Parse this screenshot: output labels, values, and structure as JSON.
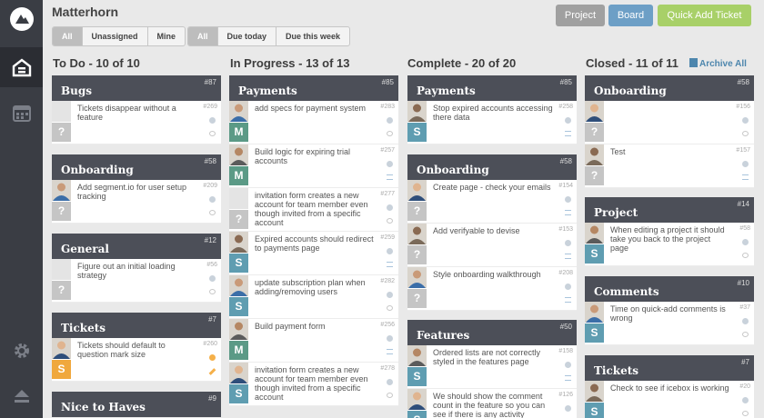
{
  "project_title": "Matterhorn",
  "filters": {
    "assignee": [
      {
        "label": "All",
        "active": true
      },
      {
        "label": "Unassigned",
        "active": false
      },
      {
        "label": "Mine",
        "active": false
      }
    ],
    "due": [
      {
        "label": "All",
        "active": true
      },
      {
        "label": "Due today",
        "active": false
      },
      {
        "label": "Due this week",
        "active": false
      }
    ]
  },
  "top_buttons": {
    "project": "Project",
    "board": "Board",
    "quick_add": "Quick Add Ticket"
  },
  "colors": {
    "project_button": "#a0a0a0",
    "board_button": "#6d9fc6",
    "quick_add_button": "#a8d068",
    "sidebar": "#3a3d44",
    "group_header": "#4c4f58"
  },
  "archive_all": "Archive All",
  "columns": [
    {
      "title": "To Do - 10 of 10",
      "groups": [
        {
          "name": "Bugs",
          "number": "#87",
          "tickets": [
            {
              "text": "Tickets disappear without a feature",
              "number": "#269",
              "initial": "?",
              "avatar": false
            }
          ]
        },
        {
          "name": "Onboarding",
          "number": "#58",
          "tickets": [
            {
              "text": "Add segment.io for user setup tracking",
              "number": "#209",
              "initial": "?",
              "avatar": true
            }
          ]
        },
        {
          "name": "General",
          "number": "#12",
          "tickets": [
            {
              "text": "Figure out an initial loading strategy",
              "number": "#56",
              "initial": "?",
              "avatar": false
            }
          ]
        },
        {
          "name": "Tickets",
          "number": "#7",
          "tickets": [
            {
              "text": "Tickets should default to question mark size",
              "number": "#260",
              "initial": "S",
              "avatar": true,
              "color": "orange"
            }
          ]
        },
        {
          "name": "Nice to Haves",
          "number": "#9",
          "tickets": []
        }
      ]
    },
    {
      "title": "In Progress - 13 of 13",
      "groups": [
        {
          "name": "Payments",
          "number": "#85",
          "tickets": [
            {
              "text": "add specs for payment system",
              "number": "#283",
              "initial": "M",
              "avatar": true
            },
            {
              "text": "Build logic for expiring trial accounts",
              "number": "#257",
              "initial": "M",
              "avatar": true
            },
            {
              "text": "invitation form creates a new account for team member even though invited from a specific account",
              "number": "#277",
              "initial": "?",
              "avatar": false
            },
            {
              "text": "Expired accounts should redirect to payments page",
              "number": "#259",
              "initial": "S",
              "avatar": true
            },
            {
              "text": "update subscription plan when adding/removing users",
              "number": "#282",
              "initial": "S",
              "avatar": true
            },
            {
              "text": "Build payment form",
              "number": "#256",
              "initial": "M",
              "avatar": true
            },
            {
              "text": "invitation form creates a new account for team member even though invited from a specific account",
              "number": "#278",
              "initial": "S",
              "avatar": true
            }
          ]
        }
      ]
    },
    {
      "title": "Complete - 20 of 20",
      "groups": [
        {
          "name": "Payments",
          "number": "#85",
          "tickets": [
            {
              "text": "Stop expired accounts accessing there data",
              "number": "#258",
              "initial": "S",
              "avatar": true
            }
          ]
        },
        {
          "name": "Onboarding",
          "number": "#58",
          "tickets": [
            {
              "text": "Create page - check your emails",
              "number": "#154",
              "initial": "?",
              "avatar": true
            },
            {
              "text": "Add verifyable to devise",
              "number": "#153",
              "initial": "?",
              "avatar": true
            },
            {
              "text": "Style onboarding walkthrough",
              "number": "#208",
              "initial": "?",
              "avatar": true
            }
          ]
        },
        {
          "name": "Features",
          "number": "#50",
          "tickets": [
            {
              "text": "Ordered lists are not correctly styled in the features page",
              "number": "#158",
              "initial": "S",
              "avatar": true
            },
            {
              "text": "We should show the comment count in the feature so you can see if there is any activity",
              "number": "#126",
              "initial": "S",
              "avatar": true
            }
          ]
        }
      ]
    },
    {
      "title": "Closed - 11 of 11",
      "groups": [
        {
          "name": "Onboarding",
          "number": "#58",
          "tickets": [
            {
              "text": "",
              "number": "#156",
              "initial": "?",
              "avatar": true
            },
            {
              "text": "Test",
              "number": "#157",
              "initial": "?",
              "avatar": true
            }
          ]
        },
        {
          "name": "Project",
          "number": "#14",
          "tickets": [
            {
              "text": "When editing a project it should take you back to the project page",
              "number": "#58",
              "initial": "S",
              "avatar": true
            }
          ]
        },
        {
          "name": "Comments",
          "number": "#10",
          "tickets": [
            {
              "text": "Time on quick-add comments is wrong",
              "number": "#37",
              "initial": "S",
              "avatar": true
            }
          ]
        },
        {
          "name": "Tickets",
          "number": "#7",
          "tickets": [
            {
              "text": "Check to see if icebox is working",
              "number": "#20",
              "initial": "S",
              "avatar": true
            }
          ]
        }
      ]
    }
  ]
}
